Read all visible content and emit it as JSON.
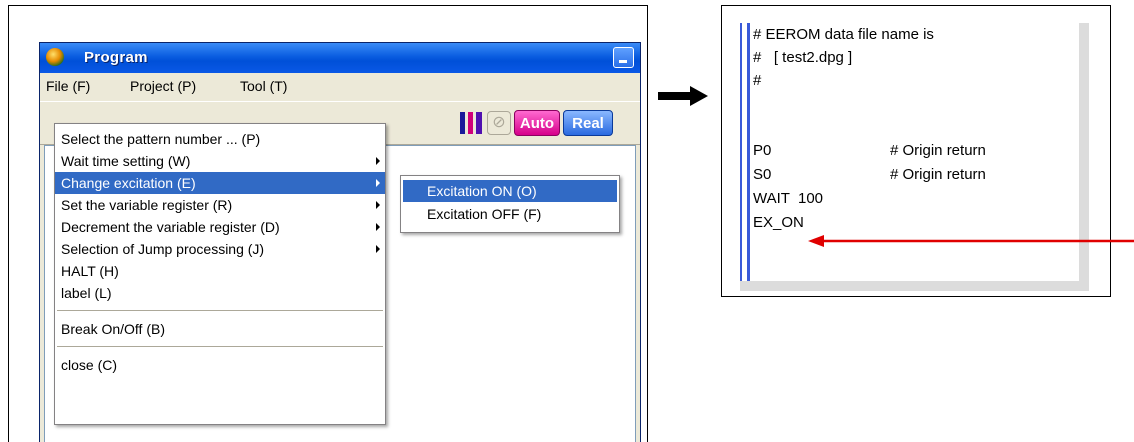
{
  "window": {
    "title": "Program"
  },
  "menubar": {
    "items": [
      "File (F)",
      "Project (P)",
      "Tool (T)"
    ]
  },
  "toolbar": {
    "disabled_glyph": "⊘",
    "auto_label": "Auto",
    "real_label": "Real"
  },
  "context_menu": {
    "items": [
      {
        "label": "Select the pattern number ... (P)",
        "submenu": false
      },
      {
        "label": "Wait time setting (W)",
        "submenu": true
      },
      {
        "label": "Change excitation (E)",
        "submenu": true,
        "highlighted": true
      },
      {
        "label": "Set the variable register (R)",
        "submenu": true
      },
      {
        "label": "Decrement the variable register (D)",
        "submenu": true
      },
      {
        "label": "Selection of Jump processing (J)",
        "submenu": true
      },
      {
        "label": "HALT (H)",
        "submenu": false
      },
      {
        "label": "label (L)",
        "submenu": false
      },
      {
        "label": "Break On/Off (B)",
        "submenu": false
      },
      {
        "label": "close (C)",
        "submenu": false
      }
    ]
  },
  "submenu": {
    "items": [
      {
        "label": "Excitation ON (O)",
        "highlighted": true
      },
      {
        "label": "Excitation OFF (F)",
        "highlighted": false
      }
    ]
  },
  "editor": {
    "lines": [
      {
        "code": "# EEROM data file name is",
        "comment": ""
      },
      {
        "code": "#   [ test2.dpg ]",
        "comment": ""
      },
      {
        "code": "#",
        "comment": ""
      },
      {
        "code": "",
        "comment": ""
      },
      {
        "code": "P0",
        "comment": "# Origin return"
      },
      {
        "code": "S0",
        "comment": "# Origin return"
      },
      {
        "code": "WAIT  100",
        "comment": ""
      },
      {
        "code": "EX_ON",
        "comment": ""
      }
    ]
  },
  "colors": {
    "highlight": "#316ac5",
    "title_bar": "#0a5de0",
    "red_arrow": "#e00000",
    "gutter_blue": "#3a5ad8"
  }
}
